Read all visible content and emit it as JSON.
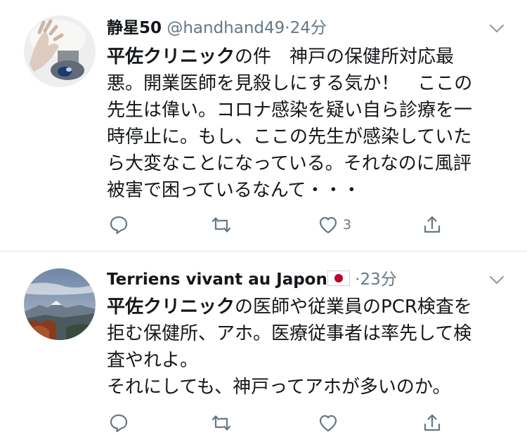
{
  "tweets": [
    {
      "display_name": "静星50",
      "handle": "@handhand49",
      "separator": "·",
      "time": "24分",
      "body_bold": "平佐クリニック",
      "body_rest": "の件　神戸の保健所対応最\n悪。開業医師を見殺しにする気か！　ここの\n先生は偉い。コロナ感染を疑い自ら診療を一\n時停止に。もし、ここの先生が感染していた\nら大変なことになっている。それなのに風評\n被害で困っているなんて・・・",
      "reply_icon": "reply-icon",
      "retweet_icon": "retweet-icon",
      "like_icon": "heart-icon",
      "share_icon": "share-icon",
      "like_count": "3"
    },
    {
      "display_name": "Terriens vivant au Japon",
      "name_emoji": "japan-flag-icon",
      "handle": "",
      "separator": "·",
      "time": "23分",
      "body_bold": "平佐クリニック",
      "body_rest": "の医師や従業員のPCR検査を\n拒む保健所、アホ。医療従事者は率先して検\n査やれよ。\nそれにしても、神戸ってアホが多いのか。",
      "reply_icon": "reply-icon",
      "retweet_icon": "retweet-icon",
      "like_icon": "heart-icon",
      "share_icon": "share-icon",
      "like_count": ""
    }
  ],
  "colors": {
    "text": "#14171a",
    "secondary": "#657786",
    "divider": "#e1e8ed"
  }
}
